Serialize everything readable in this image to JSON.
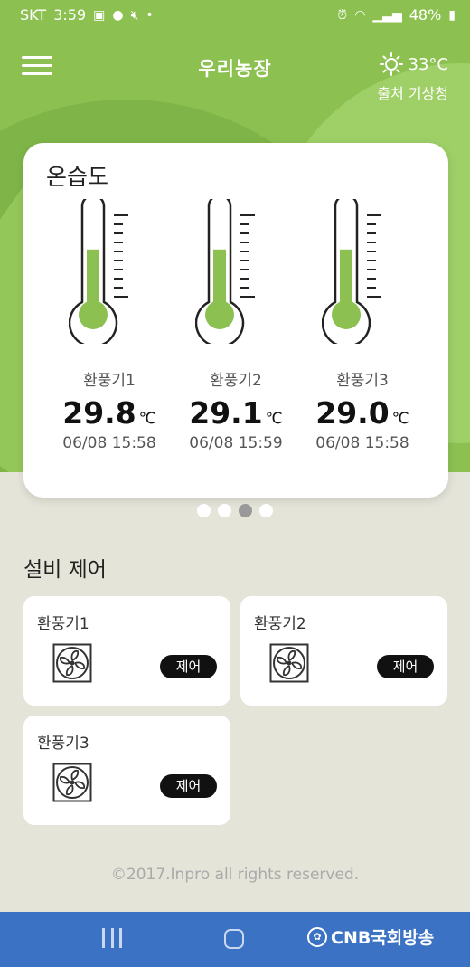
{
  "status_bar": {
    "carrier": "SKT",
    "time": "3:59",
    "battery": "48%",
    "left_icons": [
      "image-icon",
      "chat-icon",
      "mute-icon",
      "dot-icon"
    ],
    "right_icons": [
      "alarm-icon",
      "wifi-icon",
      "signal-icon",
      "battery-icon"
    ]
  },
  "header": {
    "menu_icon": "hamburger-icon",
    "title": "우리농장",
    "weather_icon": "sun-icon",
    "temperature": "33°C",
    "source": "출처 기상청"
  },
  "sensor_card": {
    "title": "온습도",
    "sensors": [
      {
        "name": "환풍기1",
        "value": "29.8",
        "unit": "℃",
        "time": "06/08 15:58",
        "level": 0.62
      },
      {
        "name": "환풍기2",
        "value": "29.1",
        "unit": "℃",
        "time": "06/08 15:59",
        "level": 0.62
      },
      {
        "name": "환풍기3",
        "value": "29.0",
        "unit": "℃",
        "time": "06/08 15:58",
        "level": 0.62
      }
    ]
  },
  "pager": {
    "count": 4,
    "active_index": 2
  },
  "equipment": {
    "title": "설비 제어",
    "devices": [
      {
        "name": "환풍기1",
        "icon": "fan-icon",
        "button": "제어"
      },
      {
        "name": "환풍기2",
        "icon": "fan-icon",
        "button": "제어"
      },
      {
        "name": "환풍기3",
        "icon": "fan-icon",
        "button": "제어"
      }
    ]
  },
  "footer": {
    "copyright": "©2017.Inpro all rights reserved."
  },
  "nav_bar": {
    "icons": [
      "recent-apps-icon",
      "home-icon"
    ],
    "watermark": "CNB국회방송"
  },
  "colors": {
    "hero_green": "#8cc152",
    "thermo_fill": "#8cc152",
    "background": "#e5e4d9",
    "nav_blue": "#3b72c4"
  }
}
